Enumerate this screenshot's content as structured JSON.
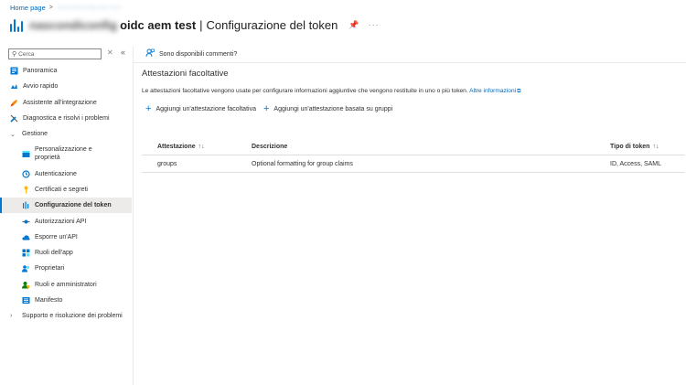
{
  "breadcrumb": {
    "home": "Home page",
    "current": "nascondiconfig aem test"
  },
  "header": {
    "title_hidden": "nascondiconfig",
    "app_name": "oidc aem test",
    "separator": "|",
    "page_title": "Configurazione del token"
  },
  "search": {
    "placeholder": "Cerca",
    "value": ""
  },
  "sidebar": {
    "items": [
      {
        "label": "Panoramica",
        "icon": "overview-icon"
      },
      {
        "label": "Avvio rapido",
        "icon": "quickstart-icon"
      },
      {
        "label": "Assistente all'integrazione",
        "icon": "rocket-icon"
      },
      {
        "label": "Diagnostica e risolvi i problemi",
        "icon": "tools-icon"
      },
      {
        "label": "Gestione",
        "icon": "chevron-down-icon",
        "group": true
      },
      {
        "label": "Personalizzazione e proprietà",
        "icon": "branding-icon"
      },
      {
        "label": "Autenticazione",
        "icon": "authentication-icon"
      },
      {
        "label": "Certificati e segreti",
        "icon": "key-icon"
      },
      {
        "label": "Configurazione del token",
        "icon": "token-config-icon",
        "selected": true
      },
      {
        "label": "Autorizzazioni API",
        "icon": "api-permissions-icon"
      },
      {
        "label": "Esporre un'API",
        "icon": "cloud-icon"
      },
      {
        "label": "Ruoli dell'app",
        "icon": "app-roles-icon"
      },
      {
        "label": "Proprietari",
        "icon": "owners-icon"
      },
      {
        "label": "Ruoli e amministratori",
        "icon": "admin-icon"
      },
      {
        "label": "Manifesto",
        "icon": "manifest-icon"
      },
      {
        "label": "Supporto e risoluzione dei problemi",
        "icon": "chevron-right-icon",
        "group": true
      }
    ]
  },
  "toolbar": {
    "feedback": "Sono disponibili commenti?"
  },
  "main": {
    "section_title": "Attestazioni facoltative",
    "description": "Le attestazioni facoltative vengono usate per configurare informazioni aggiuntive che vengono restituite in uno o più token.",
    "more_info_link": "Altre informazioni",
    "add_optional_claim": "Aggiungi un'attestazione facoltativa",
    "add_groups_claim": "Aggiungi un'attestazione basata su gruppi",
    "table": {
      "columns": [
        "Attestazione",
        "Descrizione",
        "Tipo di token"
      ],
      "rows": [
        {
          "claim": "groups",
          "description": "Optional formatting for group claims",
          "token_type": "ID, Access, SAML"
        }
      ]
    }
  },
  "colors": {
    "accent": "#0078d4",
    "link": "#0067b8",
    "selected_bg": "#edebe9",
    "text": "#323130"
  }
}
